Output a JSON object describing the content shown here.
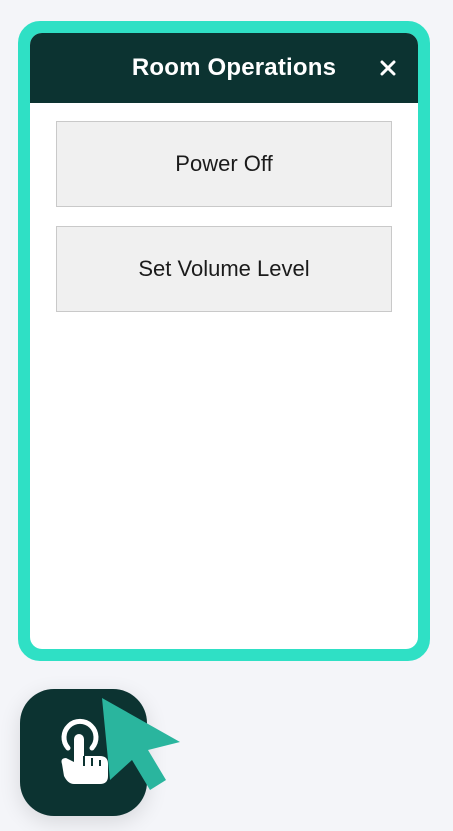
{
  "panel": {
    "title": "Room Operations",
    "close_icon": "close-icon",
    "accent_color": "#2fe0c5",
    "header_color": "#0c3331"
  },
  "operations": [
    {
      "label": "Power Off"
    },
    {
      "label": "Set Volume Level"
    }
  ],
  "fab": {
    "icon": "touch-hand-icon"
  },
  "cursor": {
    "icon": "mouse-pointer-icon",
    "color": "#2ab59e"
  }
}
